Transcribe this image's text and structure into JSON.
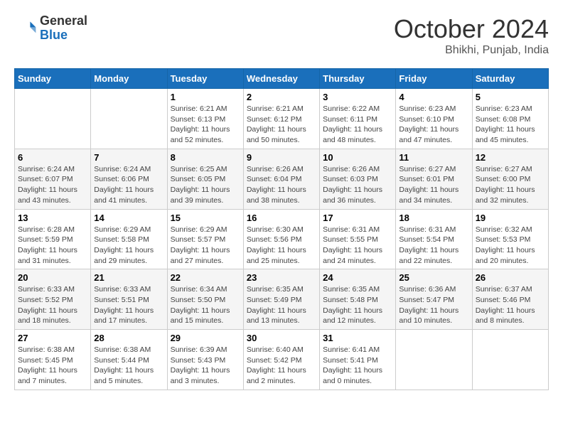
{
  "header": {
    "logo": {
      "general": "General",
      "blue": "Blue"
    },
    "title": "October 2024",
    "subtitle": "Bhikhi, Punjab, India"
  },
  "calendar": {
    "days_of_week": [
      "Sunday",
      "Monday",
      "Tuesday",
      "Wednesday",
      "Thursday",
      "Friday",
      "Saturday"
    ],
    "weeks": [
      [
        {
          "day": "",
          "sunrise": "",
          "sunset": "",
          "daylight": ""
        },
        {
          "day": "",
          "sunrise": "",
          "sunset": "",
          "daylight": ""
        },
        {
          "day": "1",
          "sunrise": "Sunrise: 6:21 AM",
          "sunset": "Sunset: 6:13 PM",
          "daylight": "Daylight: 11 hours and 52 minutes."
        },
        {
          "day": "2",
          "sunrise": "Sunrise: 6:21 AM",
          "sunset": "Sunset: 6:12 PM",
          "daylight": "Daylight: 11 hours and 50 minutes."
        },
        {
          "day": "3",
          "sunrise": "Sunrise: 6:22 AM",
          "sunset": "Sunset: 6:11 PM",
          "daylight": "Daylight: 11 hours and 48 minutes."
        },
        {
          "day": "4",
          "sunrise": "Sunrise: 6:23 AM",
          "sunset": "Sunset: 6:10 PM",
          "daylight": "Daylight: 11 hours and 47 minutes."
        },
        {
          "day": "5",
          "sunrise": "Sunrise: 6:23 AM",
          "sunset": "Sunset: 6:08 PM",
          "daylight": "Daylight: 11 hours and 45 minutes."
        }
      ],
      [
        {
          "day": "6",
          "sunrise": "Sunrise: 6:24 AM",
          "sunset": "Sunset: 6:07 PM",
          "daylight": "Daylight: 11 hours and 43 minutes."
        },
        {
          "day": "7",
          "sunrise": "Sunrise: 6:24 AM",
          "sunset": "Sunset: 6:06 PM",
          "daylight": "Daylight: 11 hours and 41 minutes."
        },
        {
          "day": "8",
          "sunrise": "Sunrise: 6:25 AM",
          "sunset": "Sunset: 6:05 PM",
          "daylight": "Daylight: 11 hours and 39 minutes."
        },
        {
          "day": "9",
          "sunrise": "Sunrise: 6:26 AM",
          "sunset": "Sunset: 6:04 PM",
          "daylight": "Daylight: 11 hours and 38 minutes."
        },
        {
          "day": "10",
          "sunrise": "Sunrise: 6:26 AM",
          "sunset": "Sunset: 6:03 PM",
          "daylight": "Daylight: 11 hours and 36 minutes."
        },
        {
          "day": "11",
          "sunrise": "Sunrise: 6:27 AM",
          "sunset": "Sunset: 6:01 PM",
          "daylight": "Daylight: 11 hours and 34 minutes."
        },
        {
          "day": "12",
          "sunrise": "Sunrise: 6:27 AM",
          "sunset": "Sunset: 6:00 PM",
          "daylight": "Daylight: 11 hours and 32 minutes."
        }
      ],
      [
        {
          "day": "13",
          "sunrise": "Sunrise: 6:28 AM",
          "sunset": "Sunset: 5:59 PM",
          "daylight": "Daylight: 11 hours and 31 minutes."
        },
        {
          "day": "14",
          "sunrise": "Sunrise: 6:29 AM",
          "sunset": "Sunset: 5:58 PM",
          "daylight": "Daylight: 11 hours and 29 minutes."
        },
        {
          "day": "15",
          "sunrise": "Sunrise: 6:29 AM",
          "sunset": "Sunset: 5:57 PM",
          "daylight": "Daylight: 11 hours and 27 minutes."
        },
        {
          "day": "16",
          "sunrise": "Sunrise: 6:30 AM",
          "sunset": "Sunset: 5:56 PM",
          "daylight": "Daylight: 11 hours and 25 minutes."
        },
        {
          "day": "17",
          "sunrise": "Sunrise: 6:31 AM",
          "sunset": "Sunset: 5:55 PM",
          "daylight": "Daylight: 11 hours and 24 minutes."
        },
        {
          "day": "18",
          "sunrise": "Sunrise: 6:31 AM",
          "sunset": "Sunset: 5:54 PM",
          "daylight": "Daylight: 11 hours and 22 minutes."
        },
        {
          "day": "19",
          "sunrise": "Sunrise: 6:32 AM",
          "sunset": "Sunset: 5:53 PM",
          "daylight": "Daylight: 11 hours and 20 minutes."
        }
      ],
      [
        {
          "day": "20",
          "sunrise": "Sunrise: 6:33 AM",
          "sunset": "Sunset: 5:52 PM",
          "daylight": "Daylight: 11 hours and 18 minutes."
        },
        {
          "day": "21",
          "sunrise": "Sunrise: 6:33 AM",
          "sunset": "Sunset: 5:51 PM",
          "daylight": "Daylight: 11 hours and 17 minutes."
        },
        {
          "day": "22",
          "sunrise": "Sunrise: 6:34 AM",
          "sunset": "Sunset: 5:50 PM",
          "daylight": "Daylight: 11 hours and 15 minutes."
        },
        {
          "day": "23",
          "sunrise": "Sunrise: 6:35 AM",
          "sunset": "Sunset: 5:49 PM",
          "daylight": "Daylight: 11 hours and 13 minutes."
        },
        {
          "day": "24",
          "sunrise": "Sunrise: 6:35 AM",
          "sunset": "Sunset: 5:48 PM",
          "daylight": "Daylight: 11 hours and 12 minutes."
        },
        {
          "day": "25",
          "sunrise": "Sunrise: 6:36 AM",
          "sunset": "Sunset: 5:47 PM",
          "daylight": "Daylight: 11 hours and 10 minutes."
        },
        {
          "day": "26",
          "sunrise": "Sunrise: 6:37 AM",
          "sunset": "Sunset: 5:46 PM",
          "daylight": "Daylight: 11 hours and 8 minutes."
        }
      ],
      [
        {
          "day": "27",
          "sunrise": "Sunrise: 6:38 AM",
          "sunset": "Sunset: 5:45 PM",
          "daylight": "Daylight: 11 hours and 7 minutes."
        },
        {
          "day": "28",
          "sunrise": "Sunrise: 6:38 AM",
          "sunset": "Sunset: 5:44 PM",
          "daylight": "Daylight: 11 hours and 5 minutes."
        },
        {
          "day": "29",
          "sunrise": "Sunrise: 6:39 AM",
          "sunset": "Sunset: 5:43 PM",
          "daylight": "Daylight: 11 hours and 3 minutes."
        },
        {
          "day": "30",
          "sunrise": "Sunrise: 6:40 AM",
          "sunset": "Sunset: 5:42 PM",
          "daylight": "Daylight: 11 hours and 2 minutes."
        },
        {
          "day": "31",
          "sunrise": "Sunrise: 6:41 AM",
          "sunset": "Sunset: 5:41 PM",
          "daylight": "Daylight: 11 hours and 0 minutes."
        },
        {
          "day": "",
          "sunrise": "",
          "sunset": "",
          "daylight": ""
        },
        {
          "day": "",
          "sunrise": "",
          "sunset": "",
          "daylight": ""
        }
      ]
    ]
  }
}
